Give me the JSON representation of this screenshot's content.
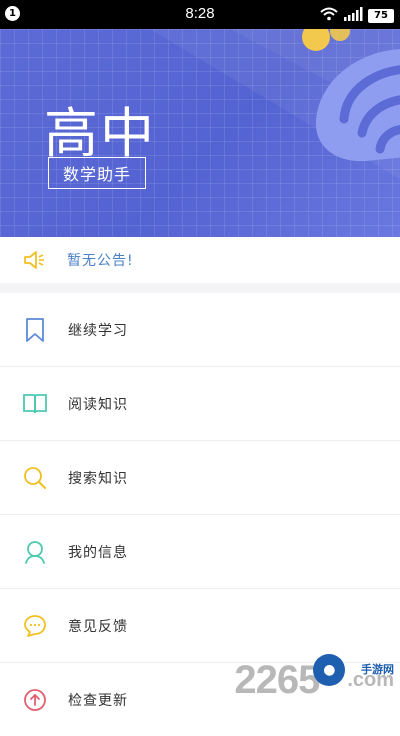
{
  "status_bar": {
    "notification_count": "1",
    "time": "8:28",
    "battery": "75",
    "icons": [
      "wifi-icon",
      "signal-icon",
      "battery-icon"
    ]
  },
  "banner": {
    "title": "高中",
    "subtitle": "数学助手",
    "decoration_icon": "monstera-leaf-icon"
  },
  "notice": {
    "icon": "megaphone-icon",
    "text": "暂无公告!"
  },
  "menu": {
    "items": [
      {
        "label": "继续学习",
        "icon": "bookmark-icon",
        "color": "#5b8ad6"
      },
      {
        "label": "阅读知识",
        "icon": "book-icon",
        "color": "#4cc9b0"
      },
      {
        "label": "搜索知识",
        "icon": "search-icon",
        "color": "#f0c020"
      },
      {
        "label": "我的信息",
        "icon": "user-icon",
        "color": "#4cc9b0"
      },
      {
        "label": "意见反馈",
        "icon": "chat-icon",
        "color": "#f0c020"
      },
      {
        "label": "检查更新",
        "icon": "upload-icon",
        "color": "#e06070"
      }
    ]
  },
  "watermark": {
    "text": "2265",
    "sub": "手游网",
    "domain": ".com"
  },
  "colors": {
    "banner": "#5463d2",
    "notice_text": "#4a80c8",
    "label_text": "#333333"
  }
}
